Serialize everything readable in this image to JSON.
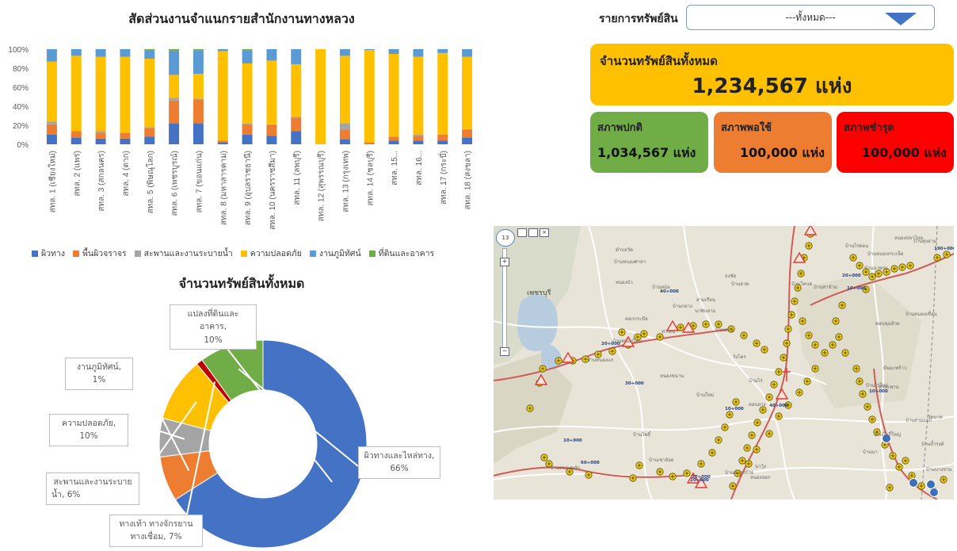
{
  "bar_chart": {
    "title": "สัดส่วนงานจำแนกรายสำนักงานทางหลวง"
  },
  "donut_chart": {
    "title": "จำนวนทรัพย์สินทั้งหมด"
  },
  "chart_data": [
    {
      "type": "bar",
      "stacked": true,
      "title": "สัดส่วนงานจำแนกรายสำนักงานทางหลวง",
      "y_ticks": [
        "100%",
        "80%",
        "60%",
        "40%",
        "20%",
        "0%"
      ],
      "ylim": [
        0,
        100
      ],
      "legend_position": "bottom",
      "categories": [
        "สทล. 1 (เชียงใหม่)",
        "สทล. 2 (แพร่)",
        "สทล. 3 (สกลนคร)",
        "สทล. 4 (ตาก)",
        "สทล. 5 (พิษณุโลก)",
        "สทล. 6 (เพชรบูรณ์)",
        "สทล. 7 (ขอนแก่น)",
        "สทล. 8 (มหาสารคาม)",
        "สทล. 9 (อุบลราชธานี)",
        "สทล. 10 (นครราชสีมา)",
        "สทล. 11 (ลพบุรี)",
        "สทล. 12 (สุพรรณบุรี)",
        "สทล. 13 (กรุงเทพ)",
        "สทล. 14 (ชลบุรี)",
        "สทล. 15...",
        "สทล. 16...",
        "สทล. 17 (กระบี่)",
        "สทล. 18 (สงขลา)"
      ],
      "series": [
        {
          "name": "ผิวทาง",
          "color": "#4472c4",
          "values": [
            10,
            7,
            6,
            6,
            8,
            22,
            22,
            2,
            10,
            9,
            14,
            0,
            5,
            0,
            4,
            4,
            4,
            7
          ]
        },
        {
          "name": "พื้นผิวจราจร",
          "color": "#ed7d31",
          "values": [
            11,
            7,
            6,
            6,
            9,
            24,
            25,
            2,
            11,
            11,
            14,
            0,
            10,
            2,
            4,
            5,
            6,
            8
          ]
        },
        {
          "name": "สะพานและงานระบายน้ำ",
          "color": "#a5a5a5",
          "values": [
            3,
            0,
            2,
            0,
            1,
            3,
            1,
            0,
            1,
            1,
            1,
            0,
            7,
            0,
            0,
            1,
            0,
            1
          ]
        },
        {
          "name": "ความปลอดภัย",
          "color": "#ffc000",
          "values": [
            63,
            79,
            78,
            80,
            72,
            24,
            26,
            94,
            63,
            67,
            55,
            100,
            71,
            97,
            87,
            82,
            86,
            76
          ]
        },
        {
          "name": "งานภูมิทัศน์",
          "color": "#5b9bd5",
          "values": [
            13,
            7,
            8,
            8,
            9,
            25,
            25,
            2,
            14,
            12,
            16,
            0,
            7,
            1,
            5,
            8,
            4,
            8
          ]
        },
        {
          "name": "ที่ดินและอาคาร",
          "color": "#70ad47",
          "values": [
            0,
            0,
            0,
            0,
            1,
            2,
            1,
            0,
            1,
            0,
            0,
            0,
            0,
            0,
            0,
            0,
            0,
            0
          ]
        }
      ]
    },
    {
      "type": "pie",
      "donut": true,
      "title": "จำนวนทรัพย์สินทั้งหมด",
      "slices": [
        {
          "label": "ผิวทางและไหล่ทาง",
          "value": 66,
          "display": "66%",
          "color": "#4472c4"
        },
        {
          "label": "ทางเท้า ทางจักรยาน ทางเชื่อม",
          "value": 7,
          "display": "7%",
          "color": "#ed7d31"
        },
        {
          "label": "สะพานและงานระบายน้ำ",
          "value": 6,
          "display": "6%",
          "color": "#a5a5a5"
        },
        {
          "label": "ความปลอดภัย",
          "value": 10,
          "display": "10%",
          "color": "#ffc000"
        },
        {
          "label": "งานภูมิทัศน์",
          "value": 1,
          "display": "1%",
          "color": "#c00000"
        },
        {
          "label": "แปลงที่ดินและอาคาร",
          "value": 10,
          "display": "10%",
          "color": "#70ad47"
        }
      ]
    }
  ],
  "callouts": {
    "land": {
      "line1": "แปลงที่ดินและอาคาร,",
      "line2": "10%"
    },
    "landscape": {
      "line1": "งานภูมิทัศน์, 1%"
    },
    "safety": {
      "line1": "ความปลอดภัย, 10%"
    },
    "bridge": {
      "line1": "สะพานและงานระบาย",
      "line2": "น้ำ, 6%"
    },
    "footpath": {
      "line1": "ทางเท้า ทางจักรยาน",
      "line2": "ทางเชื่อม, 7%"
    },
    "pavement": {
      "line1": "ผิวทางและไหล่ทาง,",
      "line2": "66%"
    }
  },
  "filter": {
    "label": "รายการทรัพย์สิน",
    "value": "---ทั้งหมด---"
  },
  "kpi": {
    "total_label": "จำนวนทรัพย์สินทั้งหมด",
    "total_value": "1,234,567 แห่ง",
    "normal_label": "สภาพปกติ",
    "normal_value": "1,034,567 แห่ง",
    "fair_label": "สภาพพอใช้",
    "fair_value": "100,000 แห่ง",
    "poor_label": "สภาพชำรุด",
    "poor_value": "100,000 แห่ง"
  },
  "colors": {
    "total": "#ffc000",
    "normal": "#70ad47",
    "fair": "#ed7d31",
    "poor": "#ff0000"
  },
  "map": {
    "place_labels": [
      "เพชรบุรี",
      "หนองบัว",
      "ตำบลวัด",
      "บ้านหนองศาลา",
      "บ้านกลาง",
      "สามเรือน",
      "นาพันสาม",
      "ธงชัย",
      "วังไคร",
      "บ้านใหม่",
      "บ้านหนองโคน",
      "หนองขนาน",
      "บ้านไร่",
      "ดอนยาง",
      "บ้านโพธิ์",
      "บ้านหนองพลับ",
      "คอกกระบือ",
      "บ้านหนองแก",
      "บ้านหม้อ",
      "บ้านดอน",
      "นาวุ้ง",
      "หนองจอก",
      "บ้านลาด",
      "ท่าเสน",
      "บ้านโตนด",
      "บ้านท่าข้าม",
      "บ้านนาพรม",
      "บ้านหนองกระเจ็ด",
      "หนองปลาไหล",
      "บ้านทุ่งสาม",
      "บ้านหนองเขื่อน",
      "ต้นมะพร้าว",
      "บ้านไร่ใหม่",
      "บ้านนา",
      "หัวสะพาน",
      "บ้านโพธิ์ใหญ่",
      "บ้านถ้ำรงค์",
      "บ้านบางจาน",
      "ดอนขุนห้วย",
      "บ้านไร่ดอน",
      "บ้านเขาย้อย",
      "บ้านหนองบ้วย",
      "บ้านสามแยก",
      "วัดนาค"
    ],
    "zoom_level": "13",
    "km_markers": [
      "40+000",
      "20+000",
      "30+000",
      "10+000",
      "20+000",
      "10+000",
      "60+000",
      "20+000",
      "10+000",
      "40+000",
      "20+000",
      "10+000",
      "190+000"
    ]
  }
}
